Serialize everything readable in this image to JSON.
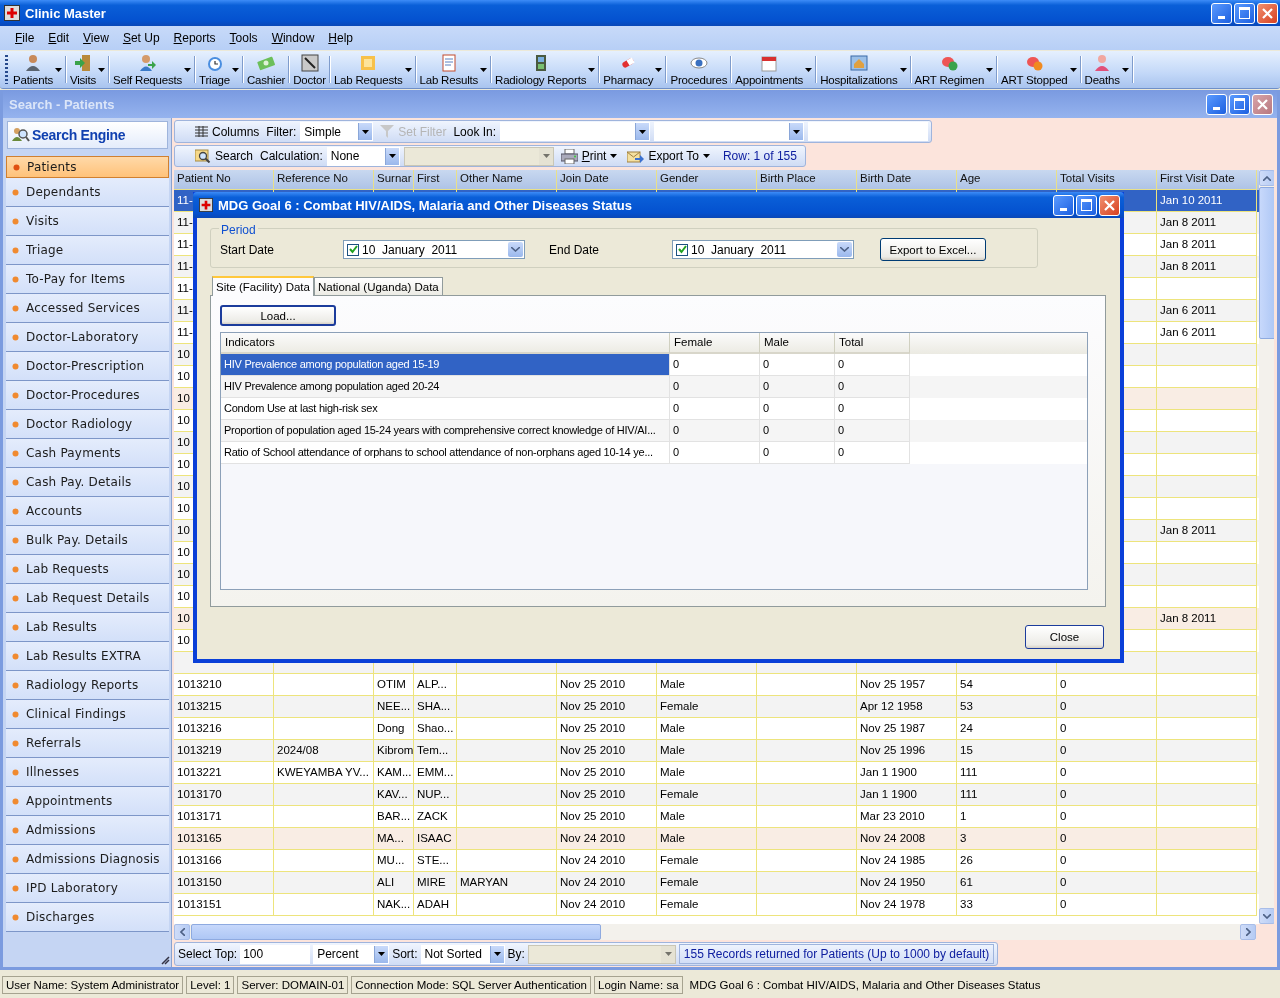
{
  "window": {
    "title": "Clinic Master"
  },
  "menu": [
    "File",
    "Edit",
    "View",
    "Set Up",
    "Reports",
    "Tools",
    "Window",
    "Help"
  ],
  "toolbar": [
    {
      "label": "Patients",
      "has_menu": true
    },
    {
      "label": "Visits",
      "has_menu": true
    },
    {
      "label": "Self Requests",
      "has_menu": true
    },
    {
      "label": "Triage",
      "has_menu": true
    },
    {
      "label": "Cashier",
      "has_menu": false
    },
    {
      "label": "Doctor",
      "has_menu": false
    },
    {
      "label": "Lab Requests",
      "has_menu": true
    },
    {
      "label": "Lab Results",
      "has_menu": true
    },
    {
      "label": "Radiology Reports",
      "has_menu": true
    },
    {
      "label": "Pharmacy",
      "has_menu": true
    },
    {
      "label": "Procedures",
      "has_menu": false
    },
    {
      "label": "Appointments",
      "has_menu": true
    },
    {
      "label": "Hospitalizations",
      "has_menu": true
    },
    {
      "label": "ART Regimen",
      "has_menu": true
    },
    {
      "label": "ART Stopped",
      "has_menu": true
    },
    {
      "label": "Deaths",
      "has_menu": true
    }
  ],
  "child_window": {
    "title": "Search - Patients"
  },
  "sidebar": {
    "header": "Search Engine",
    "items": [
      {
        "label": "Patients",
        "selected": true
      },
      {
        "label": "Dependants",
        "selected": false
      },
      {
        "label": "Visits",
        "selected": false
      },
      {
        "label": "Triage",
        "selected": false
      },
      {
        "label": "To-Pay for Items",
        "selected": false
      },
      {
        "label": "Accessed Services",
        "selected": false
      },
      {
        "label": "Doctor-Laboratory",
        "selected": false
      },
      {
        "label": "Doctor-Prescription",
        "selected": false
      },
      {
        "label": "Doctor-Procedures",
        "selected": false
      },
      {
        "label": "Doctor Radiology",
        "selected": false
      },
      {
        "label": "Cash Payments",
        "selected": false
      },
      {
        "label": "Cash Pay. Details",
        "selected": false
      },
      {
        "label": "Accounts",
        "selected": false
      },
      {
        "label": "Bulk Pay. Details",
        "selected": false
      },
      {
        "label": "Lab Requests",
        "selected": false
      },
      {
        "label": "Lab Request Details",
        "selected": false
      },
      {
        "label": "Lab Results",
        "selected": false
      },
      {
        "label": "Lab Results EXTRA",
        "selected": false
      },
      {
        "label": "Radiology Reports",
        "selected": false
      },
      {
        "label": "Clinical Findings",
        "selected": false
      },
      {
        "label": "Referrals",
        "selected": false
      },
      {
        "label": "Illnesses",
        "selected": false
      },
      {
        "label": "Appointments",
        "selected": false
      },
      {
        "label": "Admissions",
        "selected": false
      },
      {
        "label": "Admissions Diagnosis",
        "selected": false
      },
      {
        "label": "IPD Laboratory",
        "selected": false
      },
      {
        "label": "Discharges",
        "selected": false
      }
    ]
  },
  "search_bar": {
    "columns_button": "Columns",
    "filter_label": "Filter:",
    "filter_value": "Simple",
    "set_filter_button": {
      "label": "Set Filter",
      "disabled": true
    },
    "look_in_label": "Look In:"
  },
  "calc_bar": {
    "search_button": "Search",
    "calculation_label": "Calculation:",
    "calculation_value": "None",
    "print_button": "Print",
    "export_button": "Export To",
    "row_indicator": "Row: 1 of 155"
  },
  "table": {
    "columns": [
      "Patient No",
      "Reference No",
      "Surnar",
      "First",
      "Other Name",
      "Join Date",
      "Gender",
      "Birth Place",
      "Birth Date",
      "Age",
      "Total Visits",
      "First Visit Date"
    ],
    "rows": [
      {
        "cells": [
          "11-",
          null,
          null,
          null,
          null,
          null,
          null,
          null,
          null,
          null,
          null,
          "Jan 10 2011"
        ],
        "selected": true,
        "tinted": false
      },
      {
        "cells": [
          "11-",
          null,
          null,
          null,
          null,
          null,
          null,
          null,
          null,
          null,
          null,
          "Jan  8 2011"
        ],
        "selected": false,
        "tinted": false
      },
      {
        "cells": [
          "11-",
          null,
          null,
          null,
          null,
          null,
          null,
          null,
          null,
          null,
          null,
          "Jan  8 2011"
        ],
        "selected": false,
        "tinted": false
      },
      {
        "cells": [
          "11-",
          null,
          null,
          null,
          null,
          null,
          null,
          null,
          null,
          null,
          null,
          "Jan  8 2011"
        ],
        "selected": false,
        "tinted": false
      },
      {
        "cells": [
          "11-",
          null,
          null,
          null,
          null,
          null,
          null,
          null,
          null,
          null,
          null,
          null
        ],
        "selected": false,
        "tinted": false
      },
      {
        "cells": [
          "11-",
          null,
          null,
          null,
          null,
          null,
          null,
          null,
          null,
          null,
          null,
          "Jan  6 2011"
        ],
        "selected": false,
        "tinted": false
      },
      {
        "cells": [
          "11-",
          null,
          null,
          null,
          null,
          null,
          null,
          null,
          null,
          null,
          null,
          "Jan  6 2011"
        ],
        "selected": false,
        "tinted": false
      },
      {
        "cells": [
          "10",
          null,
          null,
          null,
          null,
          null,
          null,
          null,
          null,
          null,
          null,
          null
        ],
        "selected": false,
        "tinted": false
      },
      {
        "cells": [
          "10",
          null,
          null,
          null,
          null,
          null,
          null,
          null,
          null,
          null,
          null,
          null
        ],
        "selected": false,
        "tinted": false
      },
      {
        "cells": [
          "10",
          null,
          null,
          null,
          null,
          null,
          null,
          null,
          null,
          null,
          null,
          null
        ],
        "selected": false,
        "tinted": true
      },
      {
        "cells": [
          "10",
          null,
          null,
          null,
          null,
          null,
          null,
          null,
          null,
          null,
          null,
          null
        ],
        "selected": false,
        "tinted": false
      },
      {
        "cells": [
          "10",
          null,
          null,
          null,
          null,
          null,
          null,
          null,
          null,
          null,
          null,
          null
        ],
        "selected": false,
        "tinted": false
      },
      {
        "cells": [
          "10",
          null,
          null,
          null,
          null,
          null,
          null,
          null,
          null,
          null,
          null,
          null
        ],
        "selected": false,
        "tinted": false
      },
      {
        "cells": [
          "10",
          null,
          null,
          null,
          null,
          null,
          null,
          null,
          null,
          null,
          null,
          null
        ],
        "selected": false,
        "tinted": false
      },
      {
        "cells": [
          "10",
          null,
          null,
          null,
          null,
          null,
          null,
          null,
          null,
          null,
          null,
          null
        ],
        "selected": false,
        "tinted": false
      },
      {
        "cells": [
          "10",
          null,
          null,
          null,
          null,
          null,
          null,
          null,
          null,
          null,
          null,
          "Jan  8 2011"
        ],
        "selected": false,
        "tinted": false
      },
      {
        "cells": [
          "10",
          null,
          null,
          null,
          null,
          null,
          null,
          null,
          null,
          null,
          null,
          null
        ],
        "selected": false,
        "tinted": false
      },
      {
        "cells": [
          "10",
          null,
          null,
          null,
          null,
          null,
          null,
          null,
          null,
          null,
          null,
          null
        ],
        "selected": false,
        "tinted": false
      },
      {
        "cells": [
          "10",
          null,
          null,
          null,
          null,
          null,
          null,
          null,
          null,
          null,
          null,
          null
        ],
        "selected": false,
        "tinted": false
      },
      {
        "cells": [
          "10",
          null,
          null,
          null,
          null,
          null,
          null,
          null,
          null,
          null,
          null,
          "Jan  8 2011"
        ],
        "selected": false,
        "tinted": true
      },
      {
        "cells": [
          "10",
          null,
          null,
          null,
          null,
          null,
          null,
          null,
          null,
          null,
          null,
          null
        ],
        "selected": false,
        "tinted": false
      },
      {
        "cells": [
          null,
          null,
          null,
          null,
          null,
          null,
          null,
          null,
          null,
          null,
          null,
          null
        ],
        "selected": false,
        "tinted": false
      },
      {
        "cells": [
          "1013210",
          null,
          "OTIM",
          "ALP...",
          null,
          "Nov 25 2010",
          "Male",
          null,
          "Nov 25 1957",
          "54",
          "0",
          null
        ],
        "selected": false,
        "tinted": false
      },
      {
        "cells": [
          "1013215",
          null,
          "NEE...",
          "SHA...",
          null,
          "Nov 25 2010",
          "Female",
          null,
          "Apr 12 1958",
          "53",
          "0",
          null
        ],
        "selected": false,
        "tinted": false
      },
      {
        "cells": [
          "1013216",
          null,
          "Dong",
          "Shao...",
          null,
          "Nov 25 2010",
          "Male",
          null,
          "Nov 25 1987",
          "24",
          "0",
          null
        ],
        "selected": false,
        "tinted": false
      },
      {
        "cells": [
          "1013219",
          "2024/08",
          "Kibrom",
          "Tem...",
          null,
          "Nov 25 2010",
          "Male",
          null,
          "Nov 25 1996",
          "15",
          "0",
          null
        ],
        "selected": false,
        "tinted": false
      },
      {
        "cells": [
          "1013221",
          "KWEYAMBA YV...",
          "KAM...",
          "EMM...",
          null,
          "Nov 25 2010",
          "Male",
          null,
          "Jan  1 1900",
          "111",
          "0",
          null
        ],
        "selected": false,
        "tinted": false
      },
      {
        "cells": [
          "1013170",
          null,
          "KAV...",
          "NUP...",
          null,
          "Nov 25 2010",
          "Female",
          null,
          "Jan  1 1900",
          "111",
          "0",
          null
        ],
        "selected": false,
        "tinted": false
      },
      {
        "cells": [
          "1013171",
          null,
          "BAR...",
          "ZACK",
          null,
          "Nov 25 2010",
          "Male",
          null,
          "Mar 23 2010",
          "1",
          "0",
          null
        ],
        "selected": false,
        "tinted": false
      },
      {
        "cells": [
          "1013165",
          null,
          "MA...",
          "ISAAC",
          null,
          "Nov 24 2010",
          "Male",
          null,
          "Nov 24 2008",
          "3",
          "0",
          null
        ],
        "selected": false,
        "tinted": true
      },
      {
        "cells": [
          "1013166",
          null,
          "MU...",
          "STE...",
          null,
          "Nov 24 2010",
          "Female",
          null,
          "Nov 24 1985",
          "26",
          "0",
          null
        ],
        "selected": false,
        "tinted": false
      },
      {
        "cells": [
          "1013150",
          null,
          "ALI",
          "MIRE",
          "MARYAN",
          "Nov 24 2010",
          "Female",
          null,
          "Nov 24 1950",
          "61",
          "0",
          null
        ],
        "selected": false,
        "tinted": false
      },
      {
        "cells": [
          "1013151",
          null,
          "NAK...",
          "ADAH",
          null,
          "Nov 24 2010",
          "Female",
          null,
          "Nov 24 1978",
          "33",
          "0",
          null
        ],
        "selected": false,
        "tinted": false
      }
    ]
  },
  "footer": {
    "select_top_label": "Select Top:",
    "select_top_value": "100",
    "unit_value": "Percent",
    "sort_label": "Sort:",
    "sort_value": "Not Sorted",
    "by_label": "By:",
    "records_message": "155 Records returned for Patients (Up to 1000 by default)"
  },
  "status_bar": [
    "User Name: System Administrator",
    "Level: 1",
    "Server: DOMAIN-01",
    "Connection Mode: SQL Server Authentication",
    "Login Name: sa",
    "MDG Goal 6 : Combat HIV/AIDS, Malaria and Other Diseases Status"
  ],
  "dialog": {
    "title": "MDG Goal 6 : Combat HIV/AIDS, Malaria and Other Diseases Status",
    "period_label": "Period",
    "start_label": "Start Date",
    "start_date": {
      "value": "10  January  2011",
      "checked": true
    },
    "end_label": "End Date",
    "end_date": {
      "value": "10  January  2011",
      "checked": true
    },
    "export_button": "Export to Excel...",
    "tabs": [
      {
        "label": "Site (Facility) Data",
        "selected": true
      },
      {
        "label": "National (Uganda) Data",
        "selected": false
      }
    ],
    "load_button": "Load...",
    "grid": {
      "columns": [
        "Indicators",
        "Female",
        "Male",
        "Total"
      ],
      "rows": [
        {
          "cells": [
            "HIV Prevalence among population aged 15-19",
            "0",
            "0",
            "0"
          ],
          "selected": true
        },
        {
          "cells": [
            "HIV Prevalence among population aged 20-24",
            "0",
            "0",
            "0"
          ],
          "selected": false
        },
        {
          "cells": [
            "Condom Use at last high-risk sex",
            "0",
            "0",
            "0"
          ],
          "selected": false
        },
        {
          "cells": [
            "Proportion of population aged 15-24 years with comprehensive correct knowledge of HIV/AI...",
            "0",
            "0",
            "0"
          ],
          "selected": false
        },
        {
          "cells": [
            "Ratio of School attendance of orphans to school attendance of non-orphans aged 10-14 ye...",
            "0",
            "0",
            "0"
          ],
          "selected": false
        }
      ]
    },
    "close_button": "Close"
  }
}
